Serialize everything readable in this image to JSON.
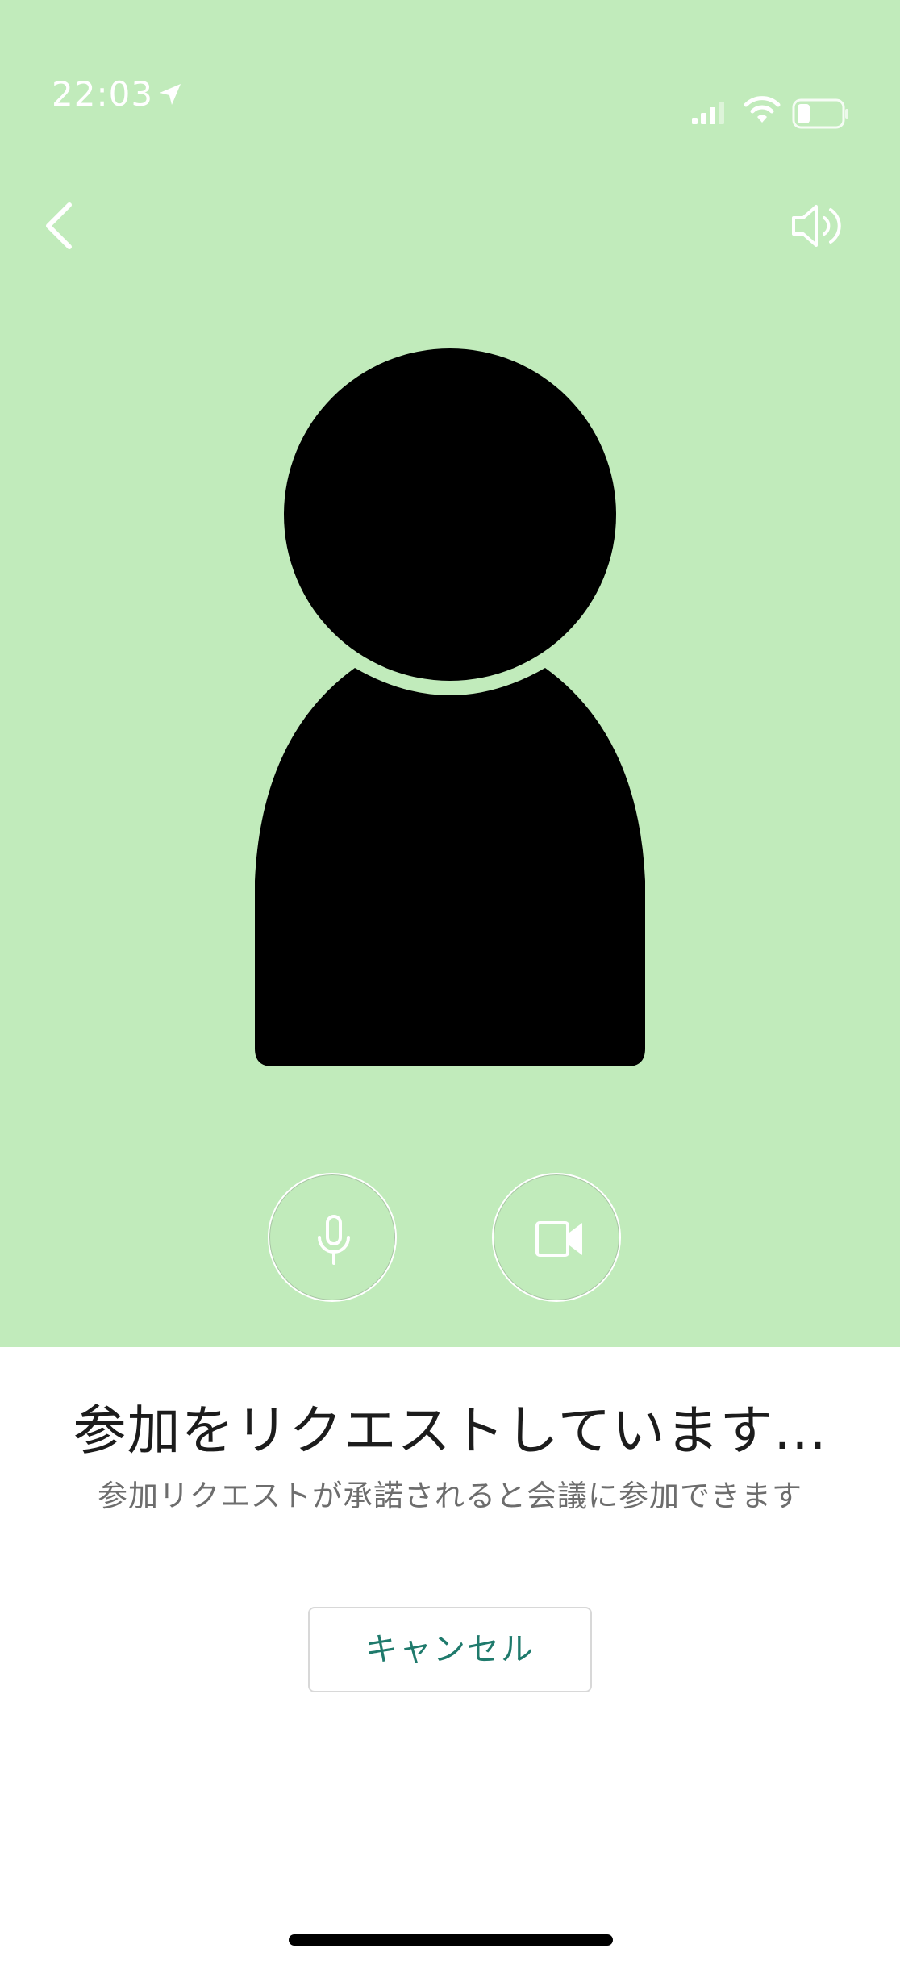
{
  "status_bar": {
    "time": "22:03",
    "icons": [
      "location-arrow-icon",
      "signal-icon",
      "wifi-icon",
      "battery-icon"
    ]
  },
  "header": {
    "back_icon": "chevron-left-icon",
    "speaker_icon": "speaker-icon"
  },
  "preview": {
    "background_color": "#c1ebbb",
    "avatar_icon": "person-silhouette-icon"
  },
  "controls": {
    "mic_icon": "microphone-icon",
    "video_icon": "video-camera-icon"
  },
  "message": {
    "title": "参加をリクエストしています...",
    "subtitle": "参加リクエストが承諾されると会議に参加できます"
  },
  "actions": {
    "cancel_label": "キャンセル",
    "accent_color": "#1f7a6c"
  }
}
